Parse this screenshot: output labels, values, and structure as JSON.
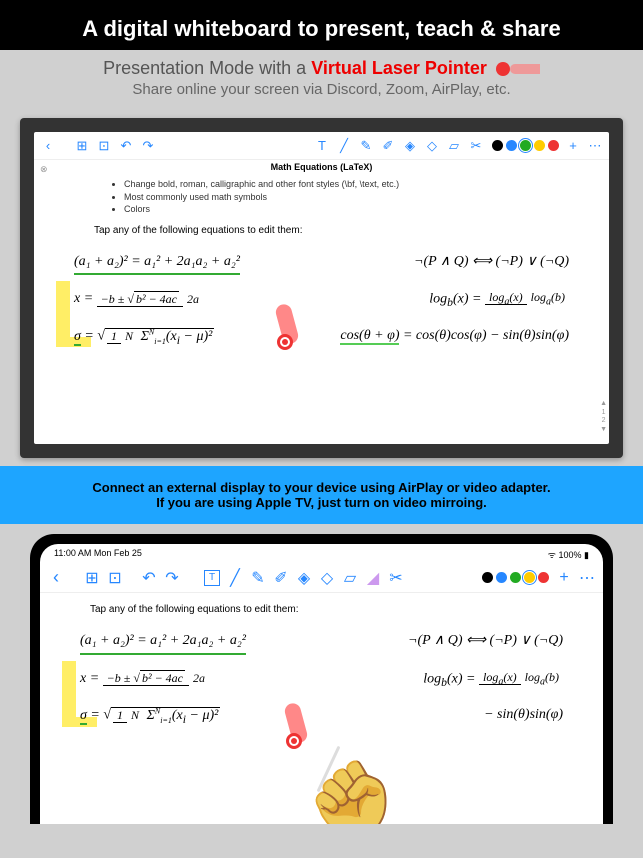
{
  "header": {
    "title": "A digital whiteboard to present, teach & share",
    "sub1_pre": "Presentation Mode with a ",
    "sub1_red": "Virtual Laser Pointer",
    "sub2": "Share online your screen via Discord, Zoom, AirPlay, etc."
  },
  "tv": {
    "doc_title": "Math Equations (LaTeX)",
    "bullets": [
      "Change bold, roman, calligraphic and other font styles (\\bf, \\text, etc.)",
      "Most commonly used math symbols",
      "Colors"
    ],
    "tap_text": "Tap any of the following equations to edit them:",
    "colors": [
      "#000",
      "#2687ff",
      "#2a2",
      "#fc0",
      "#e33"
    ],
    "selected_color": 2
  },
  "band": {
    "line1": "Connect an external display to your device using AirPlay or video adapter.",
    "line2": "If you are using Apple TV, just turn on video mirroing."
  },
  "ipad": {
    "status_left": "11:00 AM   Mon Feb 25",
    "status_right": "100%",
    "tap_text": "Tap any of the following equations to edit them:",
    "colors": [
      "#000",
      "#2687ff",
      "#2a2",
      "#fc0",
      "#e33"
    ],
    "selected_color": 3
  },
  "equations": {
    "eq1_left": "(a₁ + a₂)² = a₁² + 2a₁a₂ + a₂²",
    "eq1_right": "¬(P ∧ Q) ⟺ (¬P) ∨ (¬Q)",
    "eq2_right_pre": "log",
    "eq3_right": "cos(θ + φ) = cos(θ)cos(φ) − sin(θ)sin(φ)"
  }
}
